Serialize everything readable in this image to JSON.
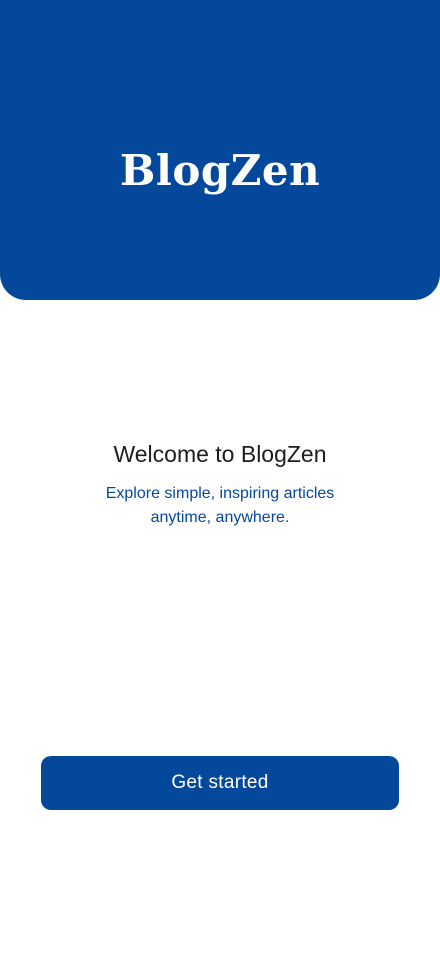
{
  "header": {
    "logo_text": "BlogZen"
  },
  "welcome": {
    "title": "Welcome to BlogZen",
    "subtitle": "Explore simple, inspiring articles anytime, anywhere."
  },
  "actions": {
    "get_started_label": "Get started"
  },
  "colors": {
    "brand_primary": "#04489b",
    "background": "#ffffff",
    "title_text": "#1c1c22"
  }
}
